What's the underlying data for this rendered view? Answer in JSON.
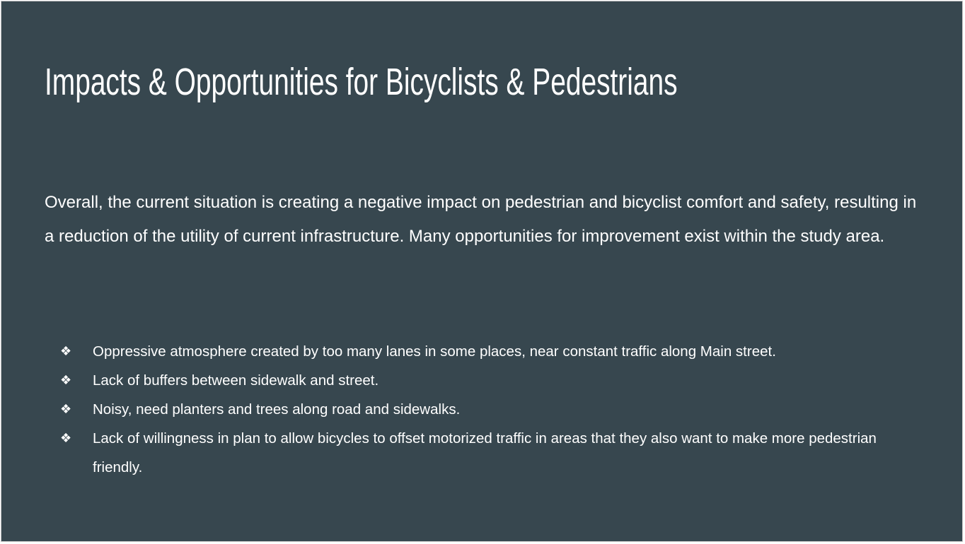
{
  "slide": {
    "title": "Impacts & Opportunities for Bicyclists & Pedestrians",
    "intro": "Overall, the current situation is creating a negative impact on pedestrian and bicyclist comfort and safety, resulting in a reduction of the utility of current infrastructure. Many opportunities for improvement exist within the study area.",
    "bullet_glyph": "❖",
    "bullets": [
      "Oppressive atmosphere created by too many lanes in some places, near constant traffic along Main street.",
      "Lack of buffers between sidewalk and street.",
      "Noisy, need planters and trees along road and sidewalks.",
      "Lack of willingness in plan to allow bicycles to offset motorized traffic in areas that they also want to make more pedestrian friendly."
    ]
  },
  "colors": {
    "background": "#37474f",
    "text": "#ffffff"
  },
  "icons": {
    "bullet": "diamond-bullet-icon"
  }
}
